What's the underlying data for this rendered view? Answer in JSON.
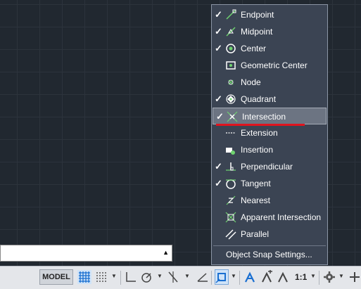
{
  "osnap_menu": {
    "items": [
      {
        "label": "Endpoint",
        "checked": true,
        "icon": "endpoint-icon"
      },
      {
        "label": "Midpoint",
        "checked": true,
        "icon": "midpoint-icon"
      },
      {
        "label": "Center",
        "checked": true,
        "icon": "center-icon"
      },
      {
        "label": "Geometric Center",
        "checked": false,
        "icon": "geometric-center-icon"
      },
      {
        "label": "Node",
        "checked": false,
        "icon": "node-icon"
      },
      {
        "label": "Quadrant",
        "checked": true,
        "icon": "quadrant-icon"
      },
      {
        "label": "Intersection",
        "checked": true,
        "icon": "intersection-icon",
        "highlighted": true
      },
      {
        "label": "Extension",
        "checked": false,
        "icon": "extension-icon"
      },
      {
        "label": "Insertion",
        "checked": false,
        "icon": "insertion-icon"
      },
      {
        "label": "Perpendicular",
        "checked": true,
        "icon": "perpendicular-icon"
      },
      {
        "label": "Tangent",
        "checked": true,
        "icon": "tangent-icon"
      },
      {
        "label": "Nearest",
        "checked": false,
        "icon": "nearest-icon"
      },
      {
        "label": "Apparent Intersection",
        "checked": false,
        "icon": "apparent-intersection-icon"
      },
      {
        "label": "Parallel",
        "checked": false,
        "icon": "parallel-icon"
      }
    ],
    "check_mark": "✓",
    "settings_label": "Object Snap Settings..."
  },
  "statusbar": {
    "model_label": "MODEL",
    "scale_label": "1:1"
  },
  "colors": {
    "canvas_bg": "#212830",
    "menu_bg": "#3b4453",
    "highlight": "#6c7482",
    "underline": "#e0141e",
    "statusbar_bg": "#e4e6ea",
    "accent_blue": "#1a6fd1"
  }
}
